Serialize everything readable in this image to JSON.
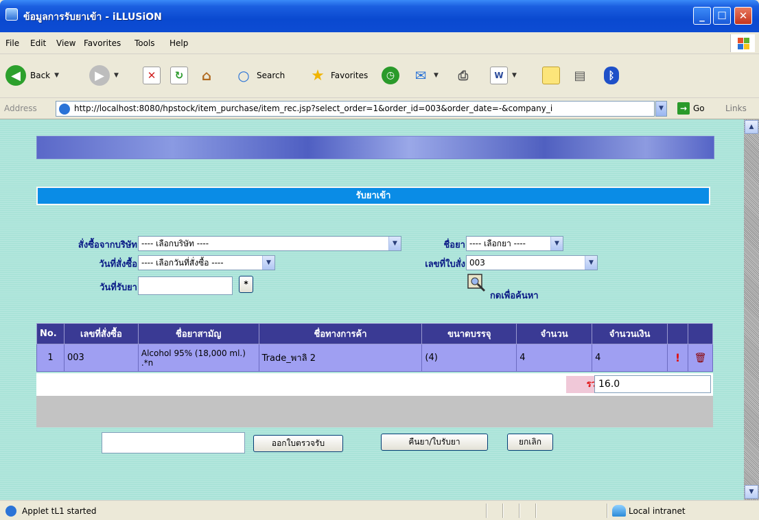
{
  "window": {
    "title": "ข้อมูลการรับยาเข้า - iLLUSiON"
  },
  "menu": [
    "File",
    "Edit",
    "View",
    "Favorites",
    "Tools",
    "Help"
  ],
  "toolbar": {
    "back": "Back",
    "search": "Search",
    "favorites": "Favorites"
  },
  "address": {
    "label": "Address",
    "url": "http://localhost:8080/hpstock/item_purchase/item_rec.jsp?select_order=1&order_id=003&order_date=-&company_i",
    "go": "Go",
    "links": "Links"
  },
  "page": {
    "section_title": "รับยาเข้า",
    "form": {
      "company_label": "สั่งซื้อจากบริษัท",
      "company_value": "---- เลือกบริษัท ----",
      "drug_label": "ชื่อยา",
      "drug_value": "---- เลือกยา ----",
      "order_date_label": "วันที่สั่งซื้อ",
      "order_date_value": "---- เลือกวันที่สั่งซื้อ ----",
      "order_no_label": "เลขที่ใบสั่ง",
      "order_no_value": "003",
      "receive_date_label": "วันที่รับยา",
      "receive_date_value": "",
      "calendar_button": "*",
      "search_label": "กดเพื่อค้นหา"
    },
    "table": {
      "headers": [
        "No.",
        "เลขที่สั่งซื้อ",
        "ชื่อยาสามัญ",
        "ชื่อทางการค้า",
        "ขนาดบรรจุ",
        "จำนวน",
        "จำนวนเงิน",
        "",
        ""
      ],
      "rows": [
        {
          "no": "1",
          "order_id": "003",
          "generic": "Alcohol 95% (18,000 ml.) .*n",
          "trade": "Trade_พาลิ 2",
          "pack": "(4)",
          "qty": "4",
          "amount": "4"
        }
      ],
      "total_label": "รวม",
      "total_value": "16.0"
    },
    "actions": {
      "input_value": "",
      "issue_receipt": "ออกใบตรวจรับ",
      "return_receipt": "คืนยา/ใบรับยา",
      "cancel": "ยกเลิก"
    }
  },
  "status": {
    "text": "Applet tL1 started",
    "zone": "Local intranet"
  },
  "colors": {
    "titlebar": "#0a49d0",
    "content_bg": "#a9e3d8",
    "table_header": "#3a3a94",
    "table_row": "#9f9ff2",
    "section_head": "#0a8ce6"
  }
}
